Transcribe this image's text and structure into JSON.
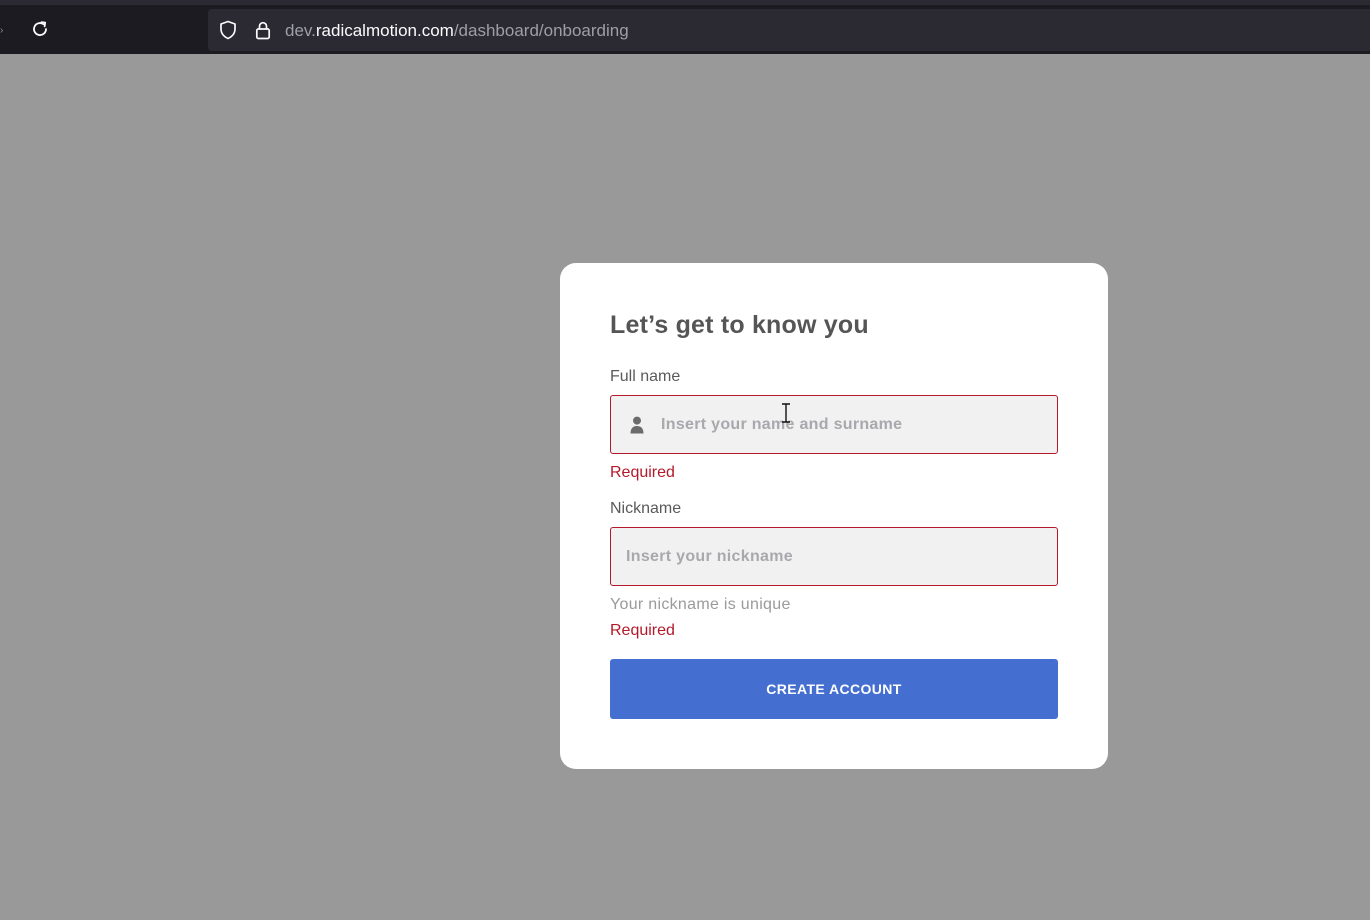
{
  "browser": {
    "url_prefix": "dev.",
    "url_domain": "radicalmotion.com",
    "url_path": "/dashboard/onboarding",
    "reload_icon": "reload-icon",
    "shield_icon": "shield-icon",
    "lock_icon": "lock-icon"
  },
  "form": {
    "title": "Let’s get to know you",
    "full_name": {
      "label": "Full name",
      "placeholder": "Insert your name and surname",
      "value": "",
      "icon": "person-icon",
      "error": "Required"
    },
    "nickname": {
      "label": "Nickname",
      "placeholder": "Insert your nickname",
      "value": "",
      "hint": "Your nickname is unique",
      "error": "Required"
    },
    "submit_label": "CREATE ACCOUNT"
  },
  "colors": {
    "backdrop": "#999999",
    "error": "#b3192a",
    "primary_button": "#446fd1",
    "browser_toolbar": "#1c1b22"
  }
}
